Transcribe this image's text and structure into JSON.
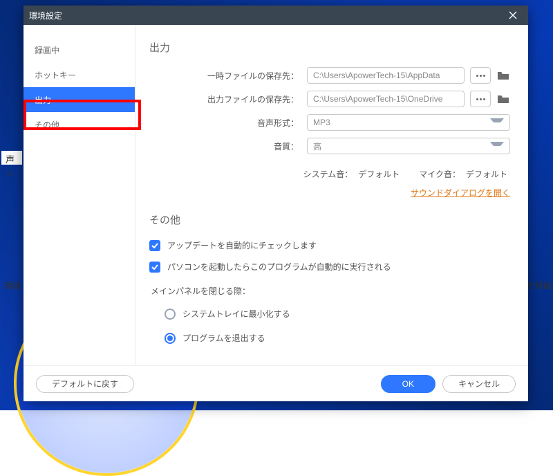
{
  "title": "環境設定",
  "sidebar": {
    "items": [
      {
        "label": "録画中"
      },
      {
        "label": "ホットキー"
      },
      {
        "label": "出力"
      },
      {
        "label": "その他"
      }
    ],
    "active_index": 2
  },
  "output": {
    "heading": "出力",
    "temp_label": "一時ファイルの保存先：",
    "temp_path": "C:\\Users\\ApowerTech-15\\AppData",
    "out_label": "出力ファイルの保存先：",
    "out_path": "C:\\Users\\ApowerTech-15\\OneDrive",
    "audio_format_label": "音声形式：",
    "audio_format_value": "MP3",
    "quality_label": "音質：",
    "quality_value": "高",
    "system_sound_label": "システム音：",
    "system_sound_value": "デフォルト",
    "mic_sound_label": "マイク音：",
    "mic_sound_value": "デフォルト",
    "sound_dialog_link": "サウンドダイアログを開く"
  },
  "other": {
    "heading": "その他",
    "auto_update": "アップデートを自動的にチェックします",
    "autostart": "パソコンを起動したらこのプログラムが自動的に実行される",
    "close_prompt": "メインパネルを閉じる際：",
    "minimize_tray": "システムトレイに最小化する",
    "exit_program": "プログラムを退出する",
    "selected_close_option": "exit_program"
  },
  "footer": {
    "reset": "デフォルトに戻す",
    "ok": "OK",
    "cancel": "キャンセル"
  },
  "back_window": {
    "left_fragment": "声 レ",
    "record_fragment1": "録画",
    "record_fragment2": "ンを録画"
  }
}
